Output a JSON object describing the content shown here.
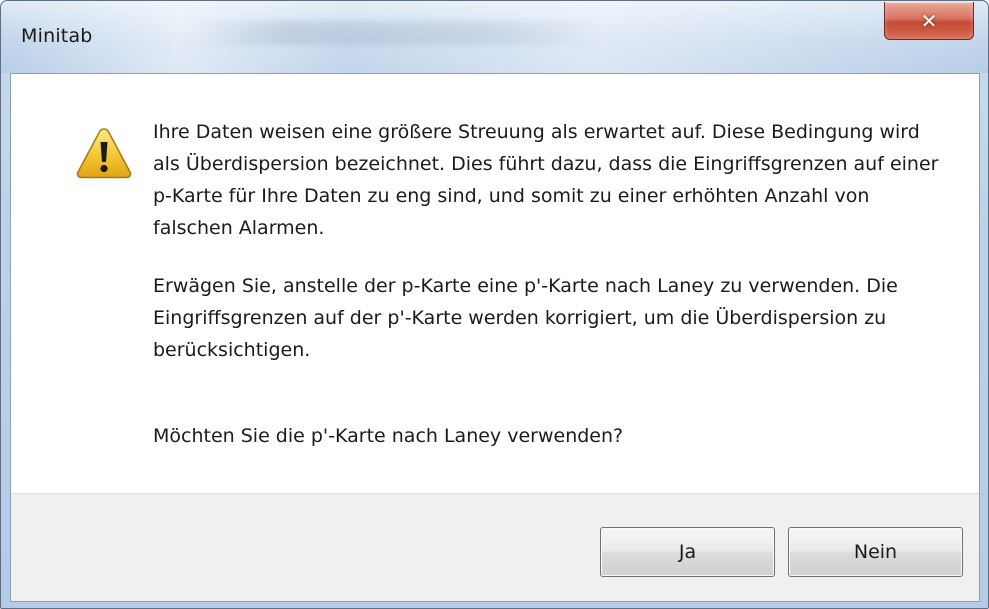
{
  "window": {
    "title": "Minitab"
  },
  "message": {
    "paragraph1": "Ihre Daten weisen eine größere Streuung als erwartet auf. Diese Bedingung wird als Überdispersion bezeichnet. Dies führt dazu, dass die Eingriffsgrenzen auf einer p-Karte für Ihre Daten zu eng sind, und somit zu einer erhöhten Anzahl von falschen Alarmen.",
    "paragraph2": "Erwägen Sie, anstelle der p-Karte eine p'-Karte nach Laney zu verwenden. Die Eingriffsgrenzen auf der p'-Karte werden korrigiert, um die Überdispersion zu berücksichtigen.",
    "question": "Möchten Sie die p'-Karte nach Laney verwenden?"
  },
  "buttons": {
    "yes_label": "Ja",
    "no_label": "Nein"
  },
  "icons": {
    "message_icon": "warning-icon",
    "close_icon": "close-icon"
  },
  "colors": {
    "warning_fill": "#f3c531",
    "close_button": "#c44a34",
    "footer_background": "#f0f0f0"
  }
}
